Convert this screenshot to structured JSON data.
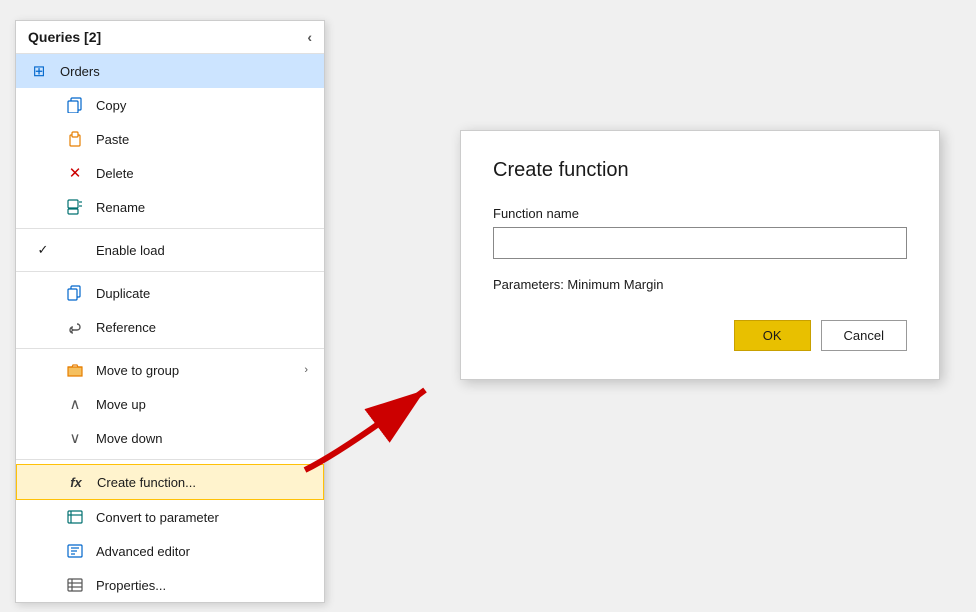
{
  "header": {
    "title": "Queries [2]",
    "collapse_label": "‹"
  },
  "orders_item": {
    "label": "Orders",
    "icon": "⊞"
  },
  "menu_items": [
    {
      "id": "copy",
      "label": "Copy",
      "icon": "📋",
      "icon_color": "icon-blue",
      "checkmark": ""
    },
    {
      "id": "paste",
      "label": "Paste",
      "icon": "📋",
      "icon_color": "icon-orange",
      "checkmark": ""
    },
    {
      "id": "delete",
      "label": "Delete",
      "icon": "✕",
      "icon_color": "icon-red",
      "checkmark": ""
    },
    {
      "id": "rename",
      "label": "Rename",
      "icon": "✏",
      "icon_color": "icon-teal",
      "checkmark": ""
    },
    {
      "id": "enable-load",
      "label": "Enable load",
      "icon": "",
      "checkmark": "✓"
    },
    {
      "id": "duplicate",
      "label": "Duplicate",
      "icon": "⧉",
      "icon_color": "icon-blue",
      "checkmark": ""
    },
    {
      "id": "reference",
      "label": "Reference",
      "icon": "↺",
      "icon_color": "icon-gray",
      "checkmark": ""
    },
    {
      "id": "move-to-group",
      "label": "Move to group",
      "icon": "📁",
      "icon_color": "icon-orange",
      "checkmark": "",
      "has_arrow": true
    },
    {
      "id": "move-up",
      "label": "Move up",
      "icon": "∧",
      "icon_color": "icon-gray",
      "checkmark": ""
    },
    {
      "id": "move-down",
      "label": "Move down",
      "icon": "∨",
      "icon_color": "icon-gray",
      "checkmark": ""
    },
    {
      "id": "create-function",
      "label": "Create function...",
      "icon": "fx",
      "icon_color": "icon-gray",
      "checkmark": "",
      "highlighted": true
    },
    {
      "id": "convert-to-parameter",
      "label": "Convert to parameter",
      "icon": "⊞",
      "icon_color": "icon-teal",
      "checkmark": ""
    },
    {
      "id": "advanced-editor",
      "label": "Advanced editor",
      "icon": "⊡",
      "icon_color": "icon-blue",
      "checkmark": ""
    },
    {
      "id": "properties",
      "label": "Properties...",
      "icon": "⊞",
      "icon_color": "icon-gray",
      "checkmark": ""
    }
  ],
  "dialog": {
    "title": "Create function",
    "function_name_label": "Function name",
    "function_name_placeholder": "",
    "params_label": "Parameters: Minimum Margin",
    "ok_label": "OK",
    "cancel_label": "Cancel"
  }
}
